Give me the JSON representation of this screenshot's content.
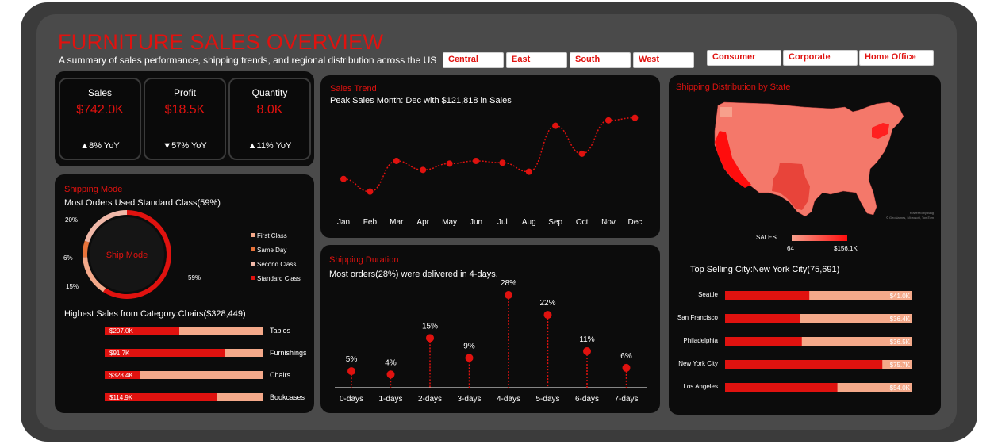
{
  "header": {
    "title": "FURNITURE SALES OVERVIEW",
    "subtitle": "A summary of sales performance, shipping trends, and regional distribution across the US"
  },
  "filters": {
    "regions": [
      "Central",
      "East",
      "South",
      "West"
    ],
    "segments": [
      "Consumer",
      "Corporate",
      "Home Office"
    ]
  },
  "kpis": [
    {
      "label": "Sales",
      "value": "$742.0K",
      "yoy": "▲8% YoY"
    },
    {
      "label": "Profit",
      "value": "$18.5K",
      "yoy": "▼57% YoY"
    },
    {
      "label": "Quantity",
      "value": "8.0K",
      "yoy": "▲11% YoY"
    }
  ],
  "colors": {
    "accent": "#e0120f",
    "light": "#f4a98a",
    "orange": "#e8733a"
  },
  "sales_trend": {
    "title": "Sales Trend",
    "subtitle": "Peak Sales Month: Dec with $121,818 in Sales"
  },
  "shipping_duration": {
    "title": "Shipping Duration",
    "subtitle": "Most orders(28%) were delivered in 4-days."
  },
  "shipping_mode": {
    "title": "Shipping Mode",
    "subtitle": "Most Orders Used Standard Class(59%)",
    "center_label": "Ship Mode",
    "category_title": "Highest Sales from Category:Chairs($328,449)"
  },
  "map": {
    "title": "Shipping Distribution by State",
    "legend_label": "SALES",
    "legend_min": "64",
    "legend_max": "$156.1K",
    "attribution_1": "Powered by Bing",
    "attribution_2": "© GeoNames, Microsoft, TomTom",
    "top_city_text": "Top Selling City:New York City(75,691)"
  },
  "chart_data": [
    {
      "type": "line",
      "title": "Sales Trend",
      "categories": [
        "Jan",
        "Feb",
        "Mar",
        "Apr",
        "May",
        "Jun",
        "Jul",
        "Aug",
        "Sep",
        "Oct",
        "Nov",
        "Dec"
      ],
      "values": [
        54000,
        40000,
        74000,
        64000,
        71000,
        74000,
        72000,
        62000,
        113000,
        82000,
        119000,
        121818
      ]
    },
    {
      "type": "scatter",
      "title": "Shipping Duration",
      "categories": [
        "0-days",
        "1-days",
        "2-days",
        "3-days",
        "4-days",
        "5-days",
        "6-days",
        "7-days"
      ],
      "values": [
        5,
        4,
        15,
        9,
        28,
        22,
        11,
        6
      ],
      "labels": [
        "5%",
        "4%",
        "15%",
        "9%",
        "28%",
        "22%",
        "11%",
        "6%"
      ]
    },
    {
      "type": "pie",
      "title": "Shipping Mode",
      "categories": [
        "First Class",
        "Same Day",
        "Second Class",
        "Standard Class"
      ],
      "values": [
        15,
        6,
        20,
        59
      ],
      "slice_labels": [
        "15%",
        "6%",
        "20%",
        "59%"
      ],
      "colors": [
        "#f4a98a",
        "#e8733a",
        "#f0b8a8",
        "#e0120f"
      ]
    },
    {
      "type": "bar",
      "title": "Highest Sales from Category:Chairs($328,449)",
      "categories": [
        "Tables",
        "Furnishings",
        "Chairs",
        "Bookcases"
      ],
      "values": [
        207.0,
        91.7,
        328.4,
        114.9
      ],
      "labels": [
        "$207.0K",
        "$91.7K",
        "$328.4K",
        "$114.9K"
      ],
      "fill_fraction": [
        0.47,
        0.76,
        0.22,
        0.71
      ]
    },
    {
      "type": "bar",
      "title": "Top Selling City:New York City(75,691)",
      "categories": [
        "Seattle",
        "San Francisco",
        "Philadelphia",
        "New York City",
        "Los Angeles"
      ],
      "values": [
        41.0,
        36.4,
        36.5,
        75.7,
        54.0
      ],
      "labels": [
        "$41.0K",
        "$36.4K",
        "$36.5K",
        "$75.7K",
        "$54.0K"
      ],
      "fill_fraction": [
        0.45,
        0.4,
        0.41,
        0.84,
        0.6
      ]
    }
  ]
}
